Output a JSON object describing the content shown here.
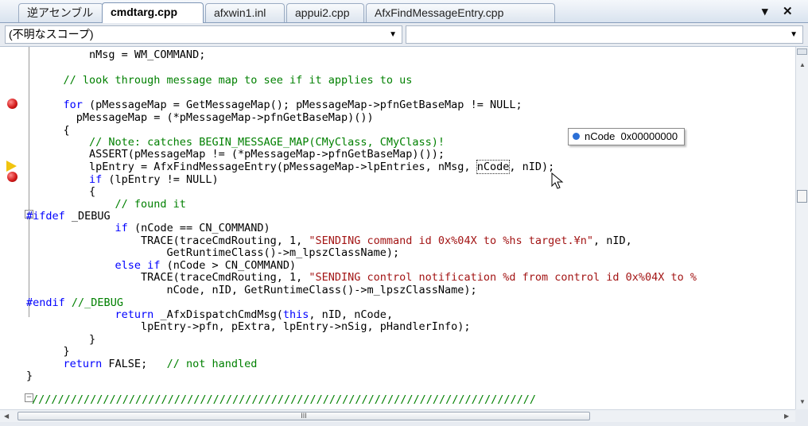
{
  "tabs": [
    {
      "label": "逆アセンブル",
      "active": false
    },
    {
      "label": "cmdtarg.cpp",
      "active": true
    },
    {
      "label": "afxwin1.inl",
      "active": false
    },
    {
      "label": "appui2.cpp",
      "active": false
    },
    {
      "label": "AfxFindMessageEntry.cpp",
      "active": false
    }
  ],
  "window_controls": {
    "dropdown": "▾",
    "close": "✕"
  },
  "scope": {
    "left": "(不明なスコープ)",
    "right": ""
  },
  "code_lines": [
    "        nMsg = WM_COMMAND;",
    "",
    "    // look through message map to see if it applies to us",
    "",
    "    for (pMessageMap = GetMessageMap(); pMessageMap->pfnGetBaseMap != NULL;",
    "      pMessageMap = (*pMessageMap->pfnGetBaseMap)())",
    "    {",
    "        // Note: catches BEGIN_MESSAGE_MAP(CMyClass, CMyClass)!",
    "        ASSERT(pMessageMap != (*pMessageMap->pfnGetBaseMap)());",
    "        lpEntry = AfxFindMessageEntry(pMessageMap->lpEntries, nMsg, nCode, nID);",
    "        if (lpEntry != NULL)",
    "        {",
    "            // found it",
    "#ifdef _DEBUG",
    "            if (nCode == CN_COMMAND)",
    "                TRACE(traceCmdRouting, 1, \"SENDING command id 0x%04X to %hs target.¥n\", nID,",
    "                    GetRuntimeClass()->m_lpszClassName);",
    "            else if (nCode > CN_COMMAND)",
    "                TRACE(traceCmdRouting, 1, \"SENDING control notification %d from control id 0x%04X to %",
    "                    nCode, nID, GetRuntimeClass()->m_lpszClassName);",
    "#endif //_DEBUG",
    "            return _AfxDispatchCmdMsg(this, nID, nCode,",
    "                lpEntry->pfn, pExtra, lpEntry->nSig, pHandlerInfo);",
    "        }",
    "    }",
    "    return FALSE;   // not handled",
    "}",
    "",
    "//////////////////////////////////////////////////////////////////////////////"
  ],
  "tooltip": {
    "name": "nCode",
    "value": "0x00000000"
  },
  "scrollbar": {
    "h_grip": "III"
  },
  "colors": {
    "keyword": "#0000ff",
    "comment": "#008000",
    "string": "#a31515",
    "breakpoint": "#d41c1c",
    "current_line_arrow": "#f1c40f"
  }
}
